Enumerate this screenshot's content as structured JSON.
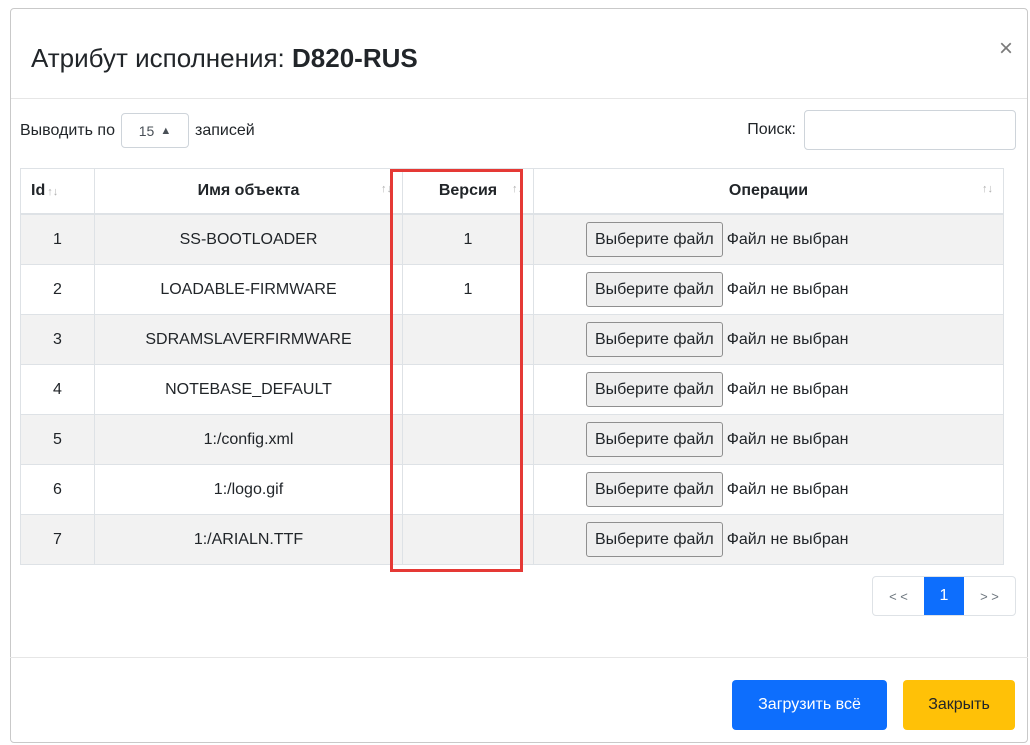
{
  "modal": {
    "title_prefix": "Атрибут исполнения: ",
    "title_name": "D820-RUS",
    "close_symbol": "×"
  },
  "controls": {
    "show_label": "Выводить по",
    "page_size": "15",
    "records_label": "записей",
    "search_label": "Поиск:",
    "search_value": ""
  },
  "table": {
    "headers": {
      "id": "Id",
      "name": "Имя объекта",
      "version": "Версия",
      "operations": "Операции"
    },
    "file_button_label": "Выберите файл",
    "file_status": "Файл не выбран",
    "rows": [
      {
        "id": "1",
        "name": "SS-BOOTLOADER",
        "version": "1"
      },
      {
        "id": "2",
        "name": "LOADABLE-FIRMWARE",
        "version": "1"
      },
      {
        "id": "3",
        "name": "SDRAMSLAVERFIRMWARE",
        "version": ""
      },
      {
        "id": "4",
        "name": "NOTEBASE_DEFAULT",
        "version": ""
      },
      {
        "id": "5",
        "name": "1:/config.xml",
        "version": ""
      },
      {
        "id": "6",
        "name": "1:/logo.gif",
        "version": ""
      },
      {
        "id": "7",
        "name": "1:/ARIALN.TTF",
        "version": ""
      }
    ]
  },
  "pagination": {
    "prev": "< <",
    "current": "1",
    "next": "> >"
  },
  "footer": {
    "upload_all_label": "Загрузить всё",
    "close_label": "Закрыть"
  },
  "colors": {
    "primary": "#0d6efd",
    "warning": "#ffc107",
    "highlight": "#e53935"
  }
}
